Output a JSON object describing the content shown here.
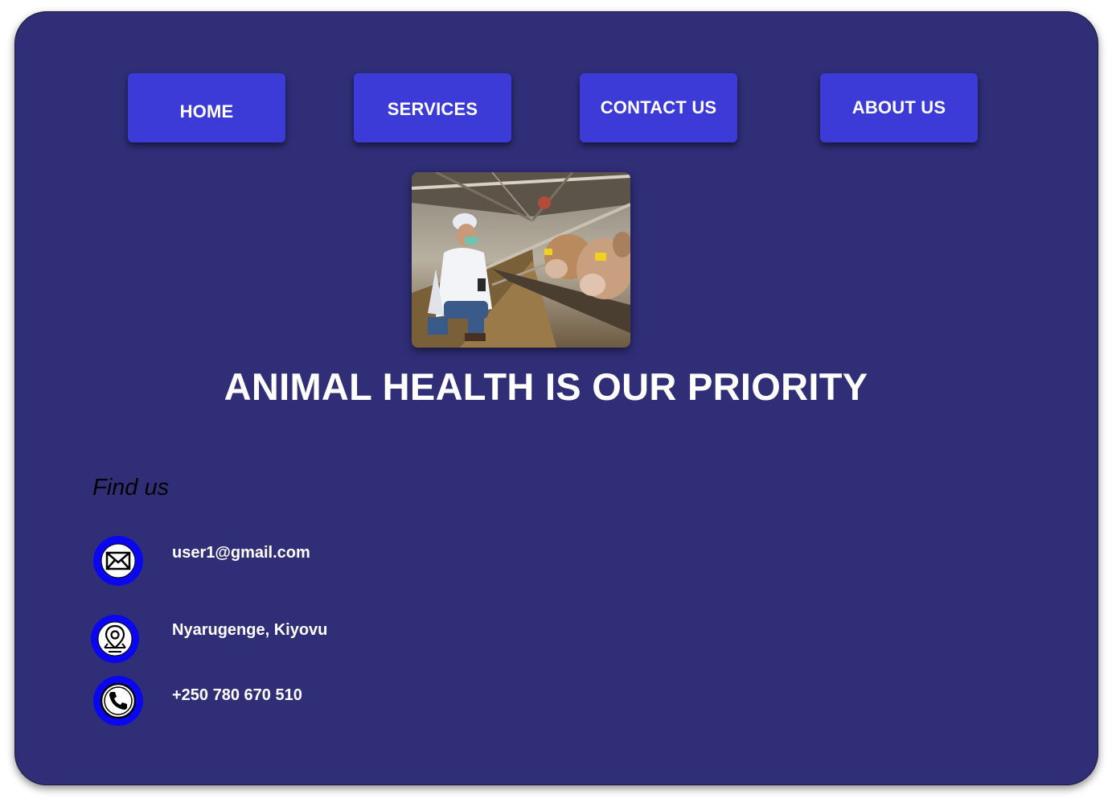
{
  "nav": {
    "home": "HOME",
    "services": "SERVICES",
    "contact": "CONTACT US",
    "about": "ABOUT US"
  },
  "hero": {
    "image": "veterinarian-with-cows-photo",
    "title": "ANIMAL HEALTH IS OUR PRIORITY"
  },
  "find_us": {
    "title": "Find us",
    "email": "user1@gmail.com",
    "location": "Nyarugenge, Kiyovu",
    "phone": "+250 780 670 510",
    "icons": [
      "mail-icon",
      "location-pin-icon",
      "phone-icon"
    ]
  },
  "colors": {
    "background": "#2f2e77",
    "button": "#3c3bd8",
    "icon_circle": "#0a06f0",
    "text": "#ffffff"
  }
}
